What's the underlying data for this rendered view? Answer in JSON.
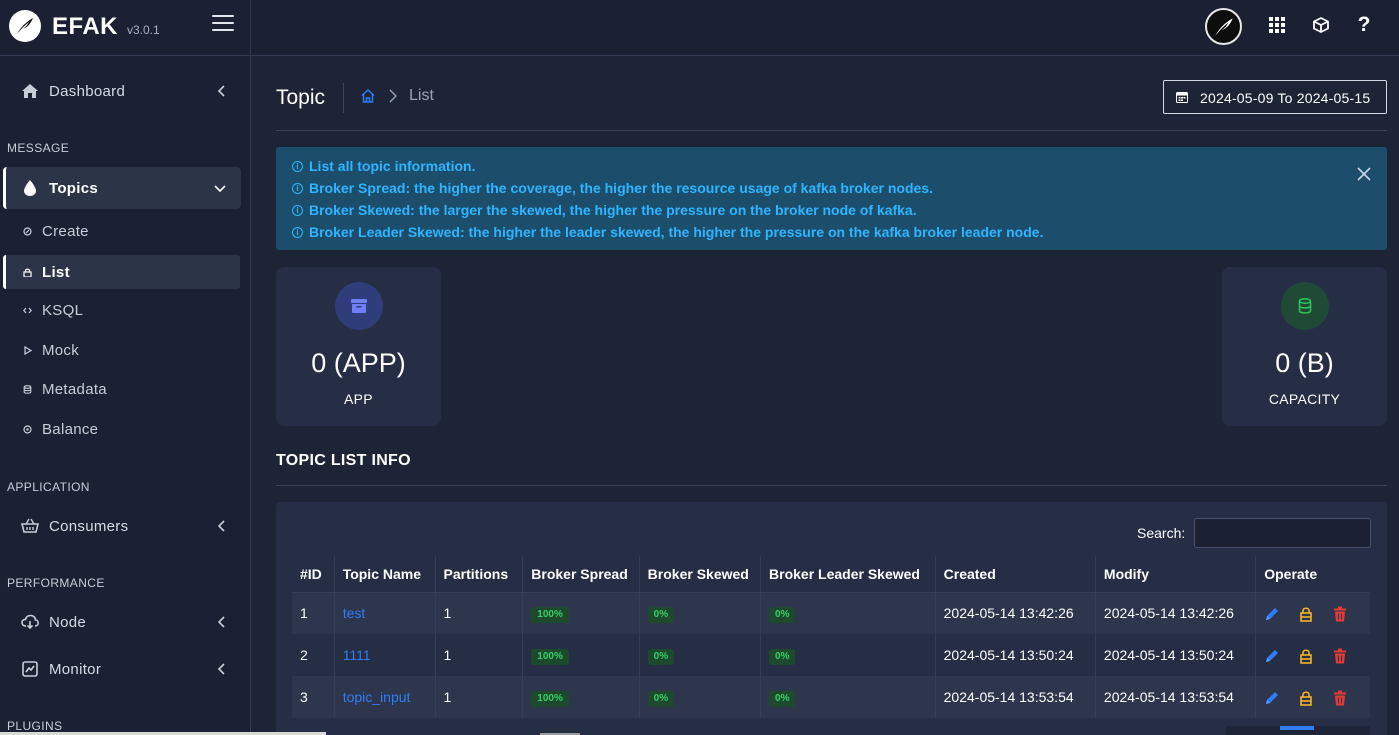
{
  "brand": {
    "name": "EFAK",
    "version": "v3.0.1"
  },
  "sidebar": {
    "dashboard": "Dashboard",
    "sections": {
      "message": "MESSAGE",
      "application": "APPLICATION",
      "performance": "PERFORMANCE",
      "plugins": "PLUGINS"
    },
    "topics": "Topics",
    "topic_sub_items": [
      {
        "label": "Create",
        "icon": "edit-icon"
      },
      {
        "label": "List",
        "icon": "lock-icon"
      },
      {
        "label": "KSQL",
        "icon": "code-icon"
      },
      {
        "label": "Mock",
        "icon": "play-icon"
      },
      {
        "label": "Metadata",
        "icon": "database-icon"
      },
      {
        "label": "Balance",
        "icon": "balance-icon"
      }
    ],
    "consumers": "Consumers",
    "node": "Node",
    "monitor": "Monitor"
  },
  "page": {
    "title": "Topic",
    "breadcrumb_current": "List",
    "date_range": "2024-05-09 To 2024-05-15"
  },
  "alert": {
    "lines": [
      "List all topic information.",
      "Broker Spread: the higher the coverage, the higher the resource usage of kafka broker nodes.",
      "Broker Skewed: the larger the skewed, the higher the pressure on the broker node of kafka.",
      "Broker Leader Skewed: the higher the leader skewed, the higher the pressure on the kafka broker leader node."
    ]
  },
  "stats": {
    "app": {
      "value": "0 (APP)",
      "label": "APP",
      "color": "#4c5bd9"
    },
    "capacity": {
      "value": "0 (B)",
      "label": "CAPACITY",
      "color": "#26b54e"
    }
  },
  "topic_list": {
    "heading": "TOPIC LIST INFO",
    "search_label": "Search:",
    "search_value": "",
    "columns": [
      "#ID",
      "Topic Name",
      "Partitions",
      "Broker Spread",
      "Broker Skewed",
      "Broker Leader Skewed",
      "Created",
      "Modify",
      "Operate"
    ],
    "rows": [
      {
        "id": "1",
        "name": "test",
        "partitions": "1",
        "spread": "100%",
        "skewed": "0%",
        "leader_skewed": "0%",
        "created": "2024-05-14 13:42:26",
        "modify": "2024-05-14 13:42:26"
      },
      {
        "id": "2",
        "name": "1111",
        "partitions": "1",
        "spread": "100%",
        "skewed": "0%",
        "leader_skewed": "0%",
        "created": "2024-05-14 13:50:24",
        "modify": "2024-05-14 13:50:24"
      },
      {
        "id": "3",
        "name": "topic_input",
        "partitions": "1",
        "spread": "100%",
        "skewed": "0%",
        "leader_skewed": "0%",
        "created": "2024-05-14 13:53:54",
        "modify": "2024-05-14 13:53:54"
      }
    ]
  },
  "colors": {
    "accent": "#2e7cf6",
    "alert_text": "#2fb5ff",
    "badge_green": "#35d06a",
    "delete_red": "#e53935",
    "lock_yellow": "#f2b327"
  }
}
